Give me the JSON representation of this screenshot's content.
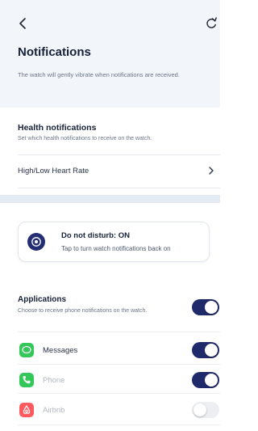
{
  "header": {
    "back_icon": "chevron-left-icon",
    "refresh_icon": "refresh-icon",
    "title": "Notifications",
    "subtitle": "The watch will gently vibrate when notifications are received."
  },
  "health": {
    "title": "Health notifications",
    "subtitle": "Set which health notifications to receive on the watch.",
    "items": [
      {
        "label": "High/Low Heart Rate",
        "icon": "chevron-right-icon"
      }
    ]
  },
  "dnd": {
    "icon": "do-not-disturb-icon",
    "title": "Do not disturb: ON",
    "subtitle": "Tap to turn watch notifications back on"
  },
  "applications": {
    "title": "Applications",
    "subtitle": "Choose to receive phone notifications on the watch.",
    "master_toggle": true,
    "apps": [
      {
        "label": "Messages",
        "icon": "messages-icon",
        "color": "#34c759",
        "enabled": true,
        "label_color": "#2a3347"
      },
      {
        "label": "Phone",
        "icon": "phone-icon",
        "color": "#34c759",
        "enabled": true,
        "label_color": "#b3b8c2"
      },
      {
        "label": "Airbnb",
        "icon": "airbnb-icon",
        "color": "#ff5a5f",
        "enabled": false,
        "label_color": "#b3b8c2"
      }
    ]
  },
  "colors": {
    "toggle_on": "#1f2a6b",
    "toggle_off": "#eceef2",
    "header_bg": "#f2f5fa"
  }
}
